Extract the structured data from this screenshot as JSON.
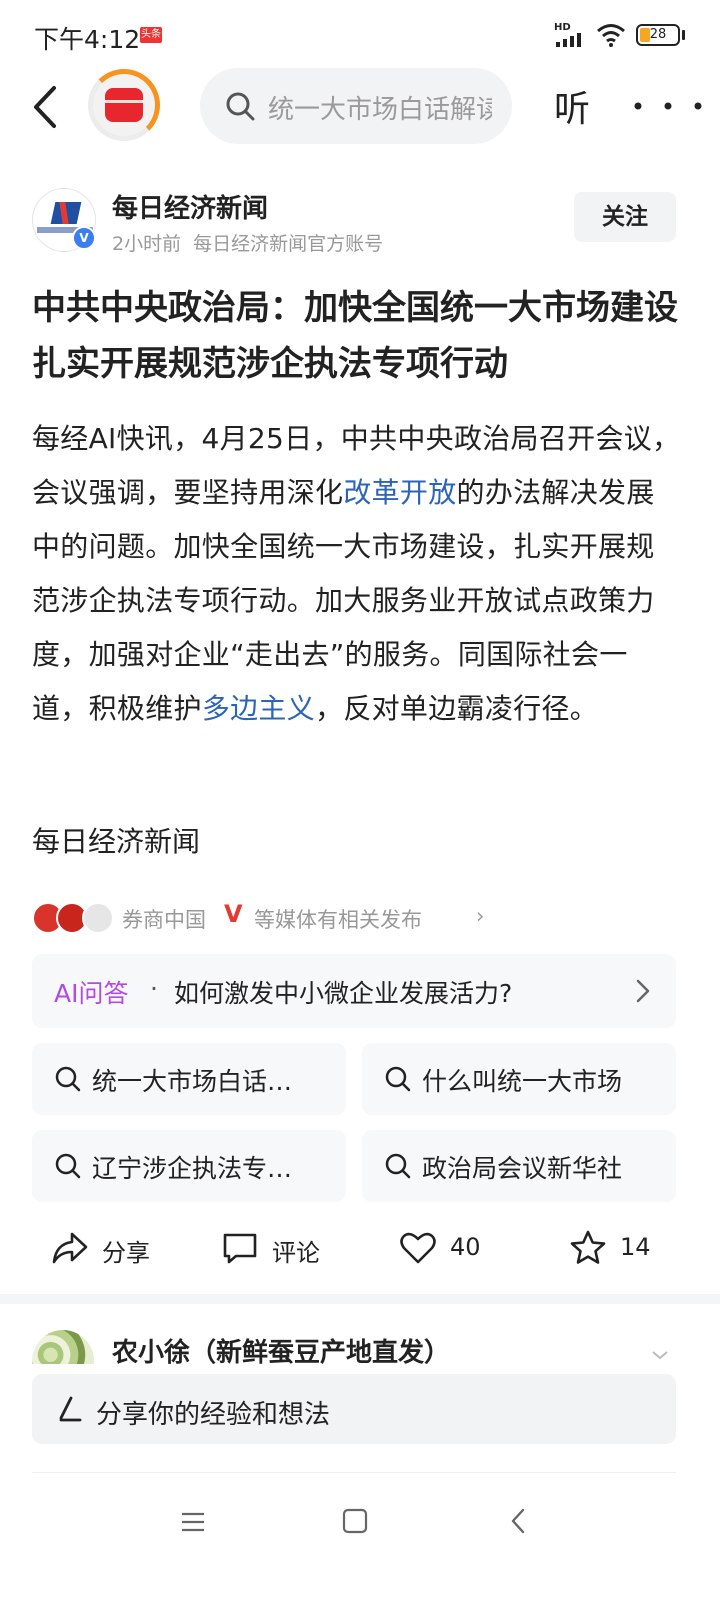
{
  "status_bar": {
    "time": "下午4:12",
    "app_badge": "头条",
    "network_label": "HD",
    "battery": "28"
  },
  "top_nav": {
    "search_placeholder": "统一大市场白话解读",
    "listen_label": "听"
  },
  "author": {
    "name": "每日经济新闻",
    "time_ago": "2小时前",
    "description": "每日经济新闻官方账号",
    "verified_mark": "V",
    "follow_label": "关注"
  },
  "article": {
    "title": "中共中央政治局：加快全国统一大市场建设 扎实开展规范涉企执法专项行动",
    "body_part1": "每经AI快讯，4月25日，中共中央政治局召开会议，会议强调，要坚持用深化",
    "link1": "改革开放",
    "body_part2": "的办法解决发展中的问题。加快全国统一大市场建设，扎实开展规范涉企执法专项行动。加大服务业开放试点政策力度，加强对企业“走出去”的服务。同国际社会一道，积极维护",
    "link2": "多边主义",
    "body_part3": "，反对单边霸凌行径。",
    "source": "每日经济新闻"
  },
  "related_media": {
    "source_name": "券商中国",
    "v_mark": "V",
    "text": "等媒体有相关发布",
    "chevron": "›"
  },
  "ai_qa": {
    "label": "AI问答",
    "separator": "·",
    "question": "如何激发中小微企业发展活力?"
  },
  "suggestions": [
    {
      "text": "统一大市场白话…"
    },
    {
      "text": "什么叫统一大市场"
    },
    {
      "text": "辽宁涉企执法专…"
    },
    {
      "text": "政治局会议新华社"
    }
  ],
  "actions": {
    "share": "分享",
    "comment": "评论",
    "likes": "40",
    "favorites": "14"
  },
  "comment_preview": {
    "commenter": "农小徐（新鲜蚕豆产地直发）",
    "input_placeholder": "分享你的经验和想法"
  },
  "colors": {
    "link": "#2b64b8",
    "ai_purple": "#b44ae6",
    "brand_red": "#e8262d",
    "accent_orange": "#f7931e",
    "chip_bg": "#f7f8fa"
  }
}
